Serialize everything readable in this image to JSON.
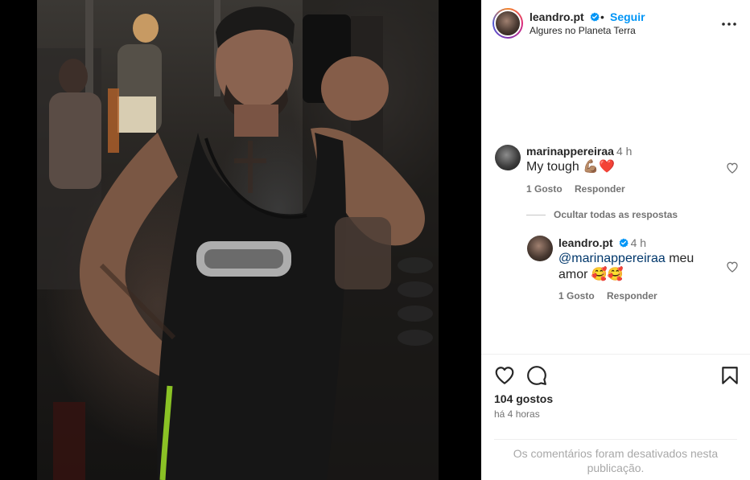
{
  "post": {
    "username": "leandro.pt",
    "verified": true,
    "separator": "•",
    "follow_label": "Seguir",
    "location": "Algures no Planeta Terra"
  },
  "comments": [
    {
      "username": "marinappereiraa",
      "time": "4 h",
      "text": "My tough 💪🏽❤️",
      "likes_label": "1 Gosto",
      "reply_label": "Responder",
      "hide_replies_label": "Ocultar todas as respostas",
      "replies": [
        {
          "username": "leandro.pt",
          "verified": true,
          "time": "4 h",
          "mention": "@marinappereiraa",
          "text_line1_rest": " meu",
          "text_line2": "amor 🥰🥰",
          "likes_label": "1 Gosto",
          "reply_label": "Responder"
        }
      ]
    }
  ],
  "actions": {
    "like_icon": "heart-outline-icon",
    "comment_icon": "comment-bubble-icon",
    "save_icon": "bookmark-icon",
    "likes_count": "104 gostos",
    "posted_ago": "há 4 horas",
    "comments_disabled": "Os comentários foram desativados nesta publicação."
  },
  "colors": {
    "link_blue": "#0095f6",
    "mention_blue": "#00376b",
    "text": "#262626",
    "muted": "#737373",
    "verified_blue": "#0095f6"
  }
}
